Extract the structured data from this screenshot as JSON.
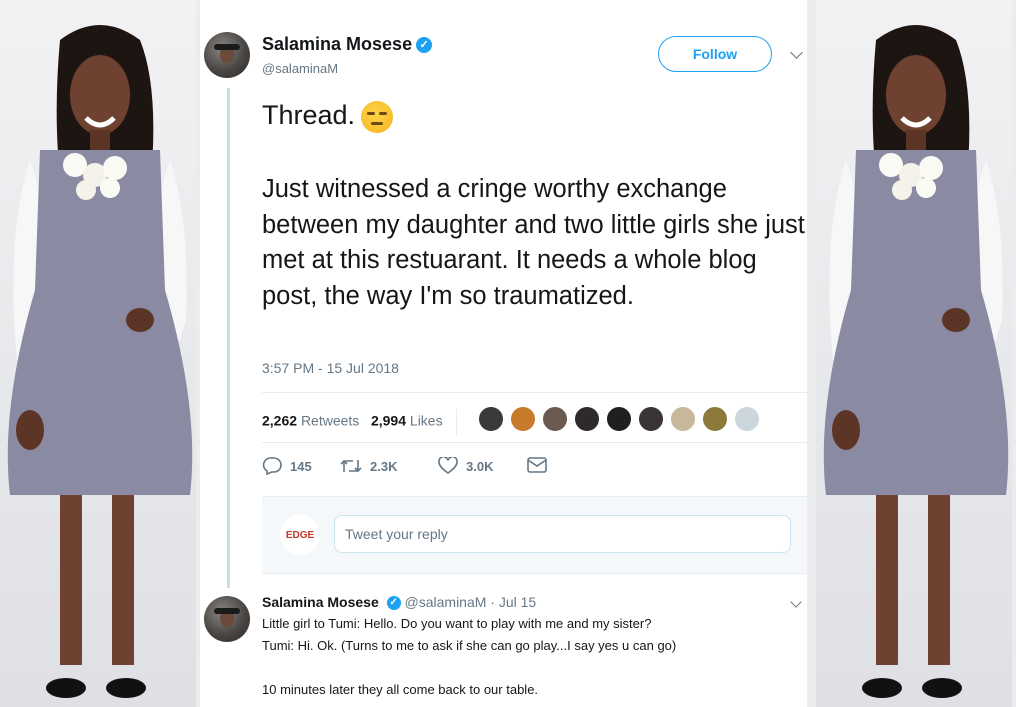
{
  "tweet": {
    "author_name": "Salamina Mosese",
    "handle": "@salaminaM",
    "follow_label": "Follow",
    "thread_label": "Thread.",
    "text": "Just witnessed a cringe worthy exchange between my daughter and two little girls she just met at this restuarant. It needs a whole blog post, the way I'm so traumatized.",
    "timestamp": "3:57 PM - 15 Jul 2018",
    "retweets_count": "2,262",
    "retweets_label": "Retweets",
    "likes_count": "2,994",
    "likes_label": "Likes",
    "reply_count": "145",
    "retweet_action_count": "2.3K",
    "like_action_count": "3.0K"
  },
  "reply_composer": {
    "logo_text": "EDGE",
    "placeholder": "Tweet your reply"
  },
  "reply_tweet": {
    "author_name": "Salamina Mosese",
    "handle_date": "@salaminaM · Jul 15",
    "lines": [
      "Little girl to Tumi: Hello. Do you want to play with me and my sister?",
      "Tumi: Hi. Ok. (Turns to me to ask if she can go play...I say yes u can go)",
      "10 minutes later they all come back to our table."
    ]
  },
  "colors": {
    "accent": "#1da1f2",
    "thread_line": "#c7e0e8",
    "text_primary": "#14171a",
    "text_secondary": "#657786"
  }
}
